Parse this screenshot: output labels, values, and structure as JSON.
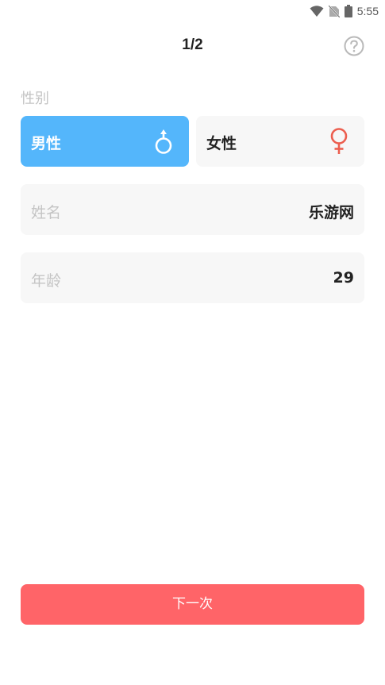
{
  "status_bar": {
    "time": "5:55",
    "icons": [
      "wifi-icon",
      "no-sim-icon",
      "battery-icon"
    ]
  },
  "header": {
    "page_indicator": "1/2",
    "help_icon": "question-circle-icon"
  },
  "gender": {
    "label": "性别",
    "options": [
      {
        "label": "男性",
        "icon": "male-symbol-icon",
        "selected": true
      },
      {
        "label": "女性",
        "icon": "female-symbol-icon",
        "selected": false
      }
    ]
  },
  "fields": {
    "name": {
      "label": "姓名",
      "value": "乐游网"
    },
    "age": {
      "label": "年龄",
      "value": "29"
    }
  },
  "next_button": {
    "label": "下一次"
  },
  "colors": {
    "male_selected": "#54b6fb",
    "female_icon": "#ec5e4f",
    "next_button": "#ff6468",
    "field_background": "#f7f7f7",
    "muted_text": "#c4c4c4"
  }
}
